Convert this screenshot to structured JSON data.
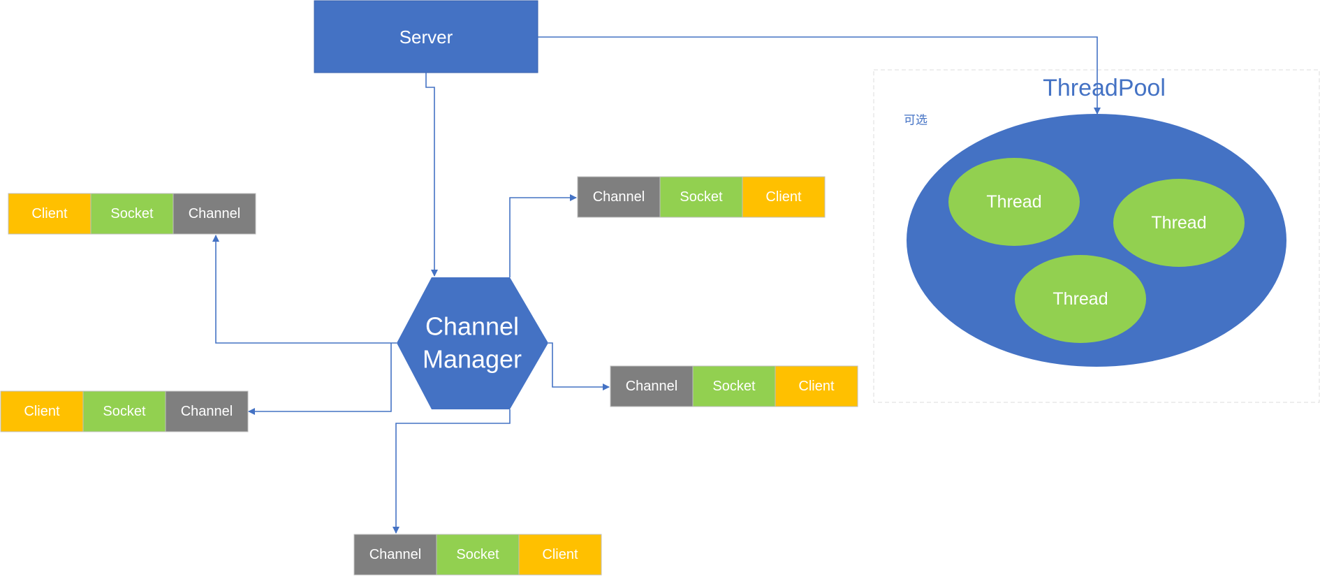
{
  "colors": {
    "blue": "#4472C4",
    "green": "#92D050",
    "yellow": "#FFC000",
    "gray": "#7F7F7F"
  },
  "server": {
    "label": "Server"
  },
  "manager": {
    "line1": "Channel",
    "line2": "Manager"
  },
  "threadpool": {
    "title": "ThreadPool",
    "note": "可选",
    "threads": [
      "Thread",
      "Thread",
      "Thread"
    ]
  },
  "rows": [
    {
      "cells": [
        "Client",
        "Socket",
        "Channel"
      ]
    },
    {
      "cells": [
        "Client",
        "Socket",
        "Channel"
      ]
    },
    {
      "cells": [
        "Channel",
        "Socket",
        "Client"
      ]
    },
    {
      "cells": [
        "Channel",
        "Socket",
        "Client"
      ]
    },
    {
      "cells": [
        "Channel",
        "Socket",
        "Client"
      ]
    }
  ]
}
